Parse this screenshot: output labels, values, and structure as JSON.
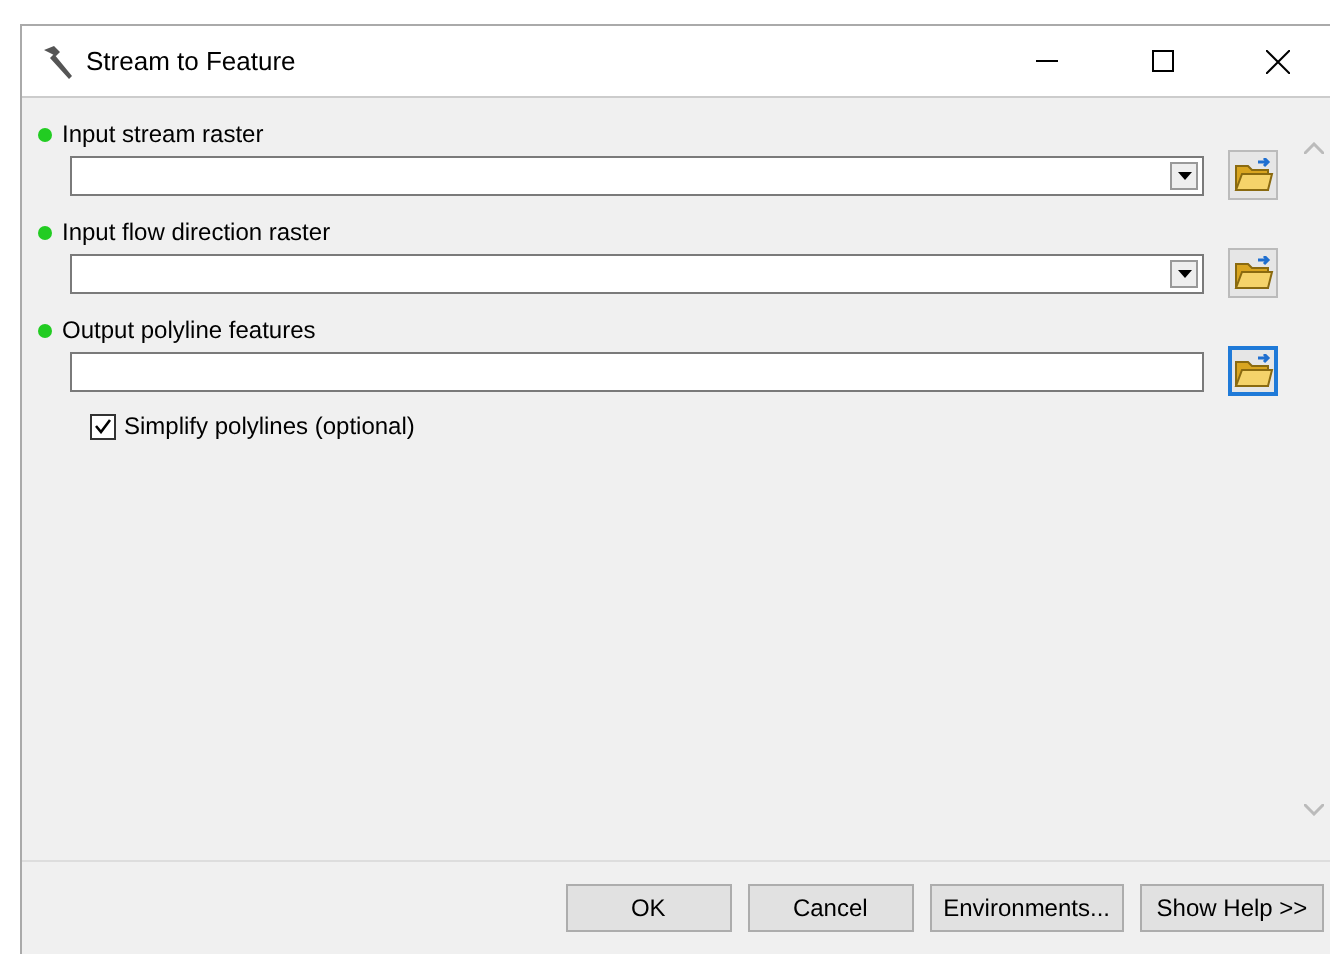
{
  "window": {
    "title": "Stream to Feature"
  },
  "parameters": [
    {
      "label": "Input stream raster",
      "required": true,
      "kind": "combo",
      "focused": false
    },
    {
      "label": "Input flow direction raster",
      "required": true,
      "kind": "combo",
      "focused": false
    },
    {
      "label": "Output polyline features",
      "required": true,
      "kind": "text",
      "focused": true
    }
  ],
  "options": [
    {
      "label": "Simplify polylines (optional)",
      "checked": true
    }
  ],
  "buttons": [
    "OK",
    "Cancel",
    "Environments...",
    "Show Help >>"
  ]
}
